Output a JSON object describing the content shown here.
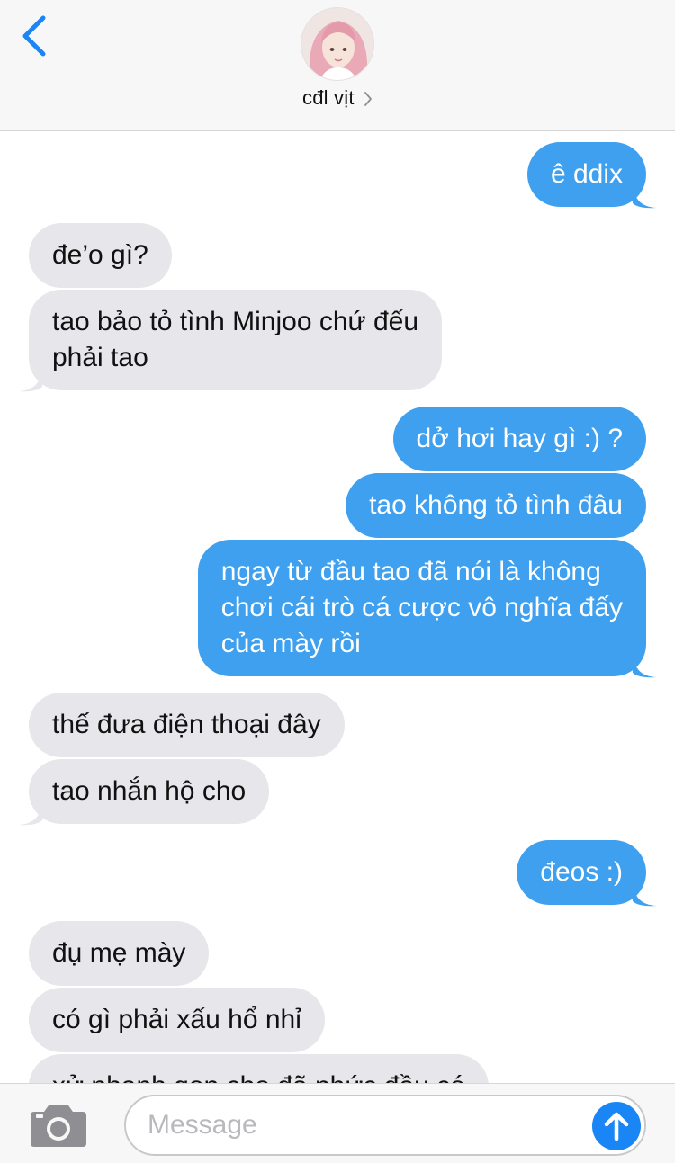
{
  "header": {
    "contact_name": "cđl vịt"
  },
  "messages": [
    {
      "side": "out",
      "lines": [
        "ê ddix"
      ]
    },
    {
      "side": "in",
      "lines": [
        "đe’o gì?"
      ]
    },
    {
      "side": "in",
      "lines": [
        "tao bảo tỏ tình Minjoo chứ đếu",
        "phải tao"
      ]
    },
    {
      "side": "out",
      "lines": [
        "dở hơi hay gì :) ?"
      ]
    },
    {
      "side": "out",
      "lines": [
        "tao không tỏ tình đâu"
      ]
    },
    {
      "side": "out",
      "lines": [
        "ngay từ đầu tao đã nói là không",
        "chơi cái trò cá cược vô nghĩa đấy",
        "của mày rồi"
      ]
    },
    {
      "side": "in",
      "lines": [
        "thế đưa điện thoại đây"
      ]
    },
    {
      "side": "in",
      "lines": [
        "tao nhắn hộ cho"
      ]
    },
    {
      "side": "out",
      "lines": [
        "đeos :)"
      ]
    },
    {
      "side": "in",
      "lines": [
        "đụ mẹ mày"
      ]
    },
    {
      "side": "in",
      "lines": [
        "có gì phải xấu hổ nhỉ"
      ]
    },
    {
      "side": "in",
      "lines": [
        "xử nhanh gọn cho đã nhức đầu có"
      ]
    }
  ],
  "compose": {
    "placeholder": "Message"
  },
  "icons": {
    "back": "chevron-left-icon",
    "camera": "camera-icon",
    "send": "arrow-up-icon"
  },
  "colors": {
    "accent": "#1a85f4",
    "outgoing_bubble": "#3ea0ee",
    "incoming_bubble": "#e7e7eb"
  }
}
